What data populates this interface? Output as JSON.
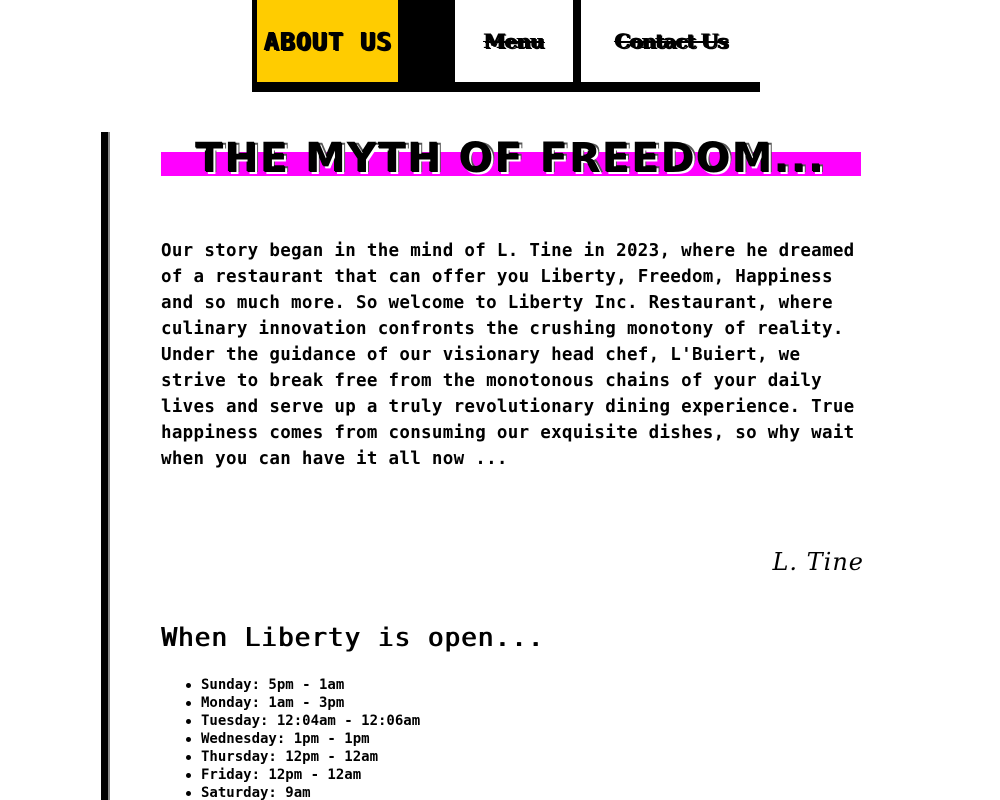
{
  "nav": {
    "tabs": [
      {
        "label": "ABOUT US",
        "active": true
      },
      {
        "label": "Menu",
        "active": false
      },
      {
        "label": "Contact Us",
        "active": false
      }
    ]
  },
  "colors": {
    "active_tab": "#FFCC00",
    "title_highlight": "#FF00FF",
    "text": "#000000",
    "background": "#FFFFFF"
  },
  "main": {
    "title": "THE MYTH OF FREEDOM...",
    "story": "Our story began in the mind of L. Tine in 2023, where he dreamed of a restaurant that can offer you Liberty, Freedom, Happiness and so much more. So welcome to Liberty Inc. Restaurant, where culinary innovation confronts the crushing monotony of reality. Under the guidance of our visionary head chef, L'Buiert, we strive to break free from the monotonous chains of your daily lives and serve up a truly revolutionary dining experience. True happiness comes from consuming our exquisite dishes, so why wait when you can have it all now ...",
    "signature": "L. Tine",
    "hours_title": "When Liberty is open...",
    "hours": [
      "Sunday: 5pm - 1am",
      "Monday: 1am - 3pm",
      "Tuesday: 12:04am - 12:06am",
      "Wednesday: 1pm - 1pm",
      "Thursday: 12pm - 12am",
      "Friday: 12pm - 12am",
      "Saturday: 9am"
    ]
  }
}
